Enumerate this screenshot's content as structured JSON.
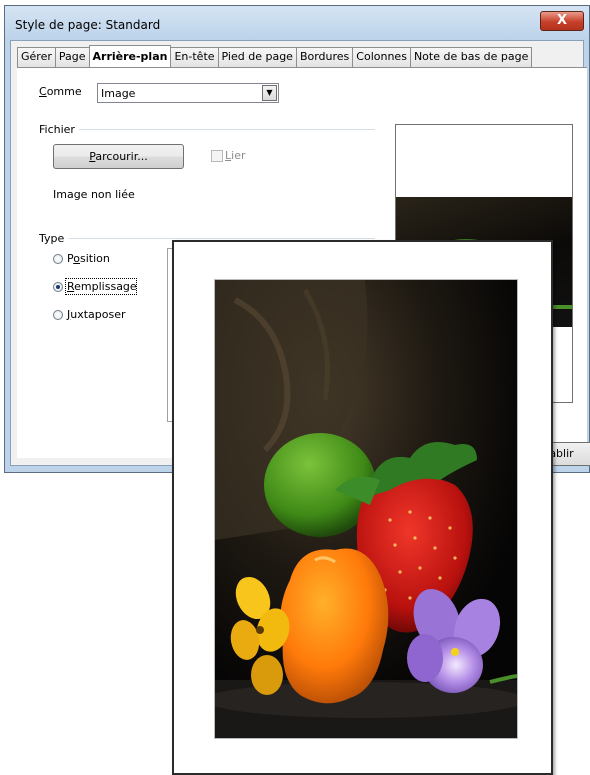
{
  "window": {
    "title": "Style de page: Standard",
    "close_glyph": "X"
  },
  "tabs": [
    {
      "label": "Gérer",
      "active": false
    },
    {
      "label": "Page",
      "active": false
    },
    {
      "label": "Arrière-plan",
      "active": true
    },
    {
      "label": "En-tête",
      "active": false
    },
    {
      "label": "Pied de page",
      "active": false
    },
    {
      "label": "Bordures",
      "active": false
    },
    {
      "label": "Colonnes",
      "active": false
    },
    {
      "label": "Note de bas de page",
      "active": false
    }
  ],
  "as_field": {
    "label_accel": "C",
    "label_rest": "omme",
    "value": "Image"
  },
  "file_section": {
    "title": "Fichier",
    "browse_accel": "P",
    "browse_rest": "arcourir...",
    "link_accel": "L",
    "link_rest": "ier",
    "link_checked": false,
    "status": "Image non liée"
  },
  "type_section": {
    "title": "Type",
    "options": [
      {
        "pre": "P",
        "accel": "o",
        "post": "sition",
        "checked": false
      },
      {
        "pre": "",
        "accel": "R",
        "post": "emplissage",
        "checked": true
      },
      {
        "pre": "",
        "accel": "J",
        "post": "uxtaposer",
        "checked": false
      }
    ]
  },
  "footer": {
    "reset_partial": "tablir"
  },
  "icons": [
    "close-icon",
    "dropdown-arrow-icon",
    "checkbox-icon",
    "radio-icon"
  ],
  "colors": {
    "titlebar": "#bcd3ea",
    "close_button": "#c6402a",
    "dialog_bg": "#f0f0f0"
  }
}
